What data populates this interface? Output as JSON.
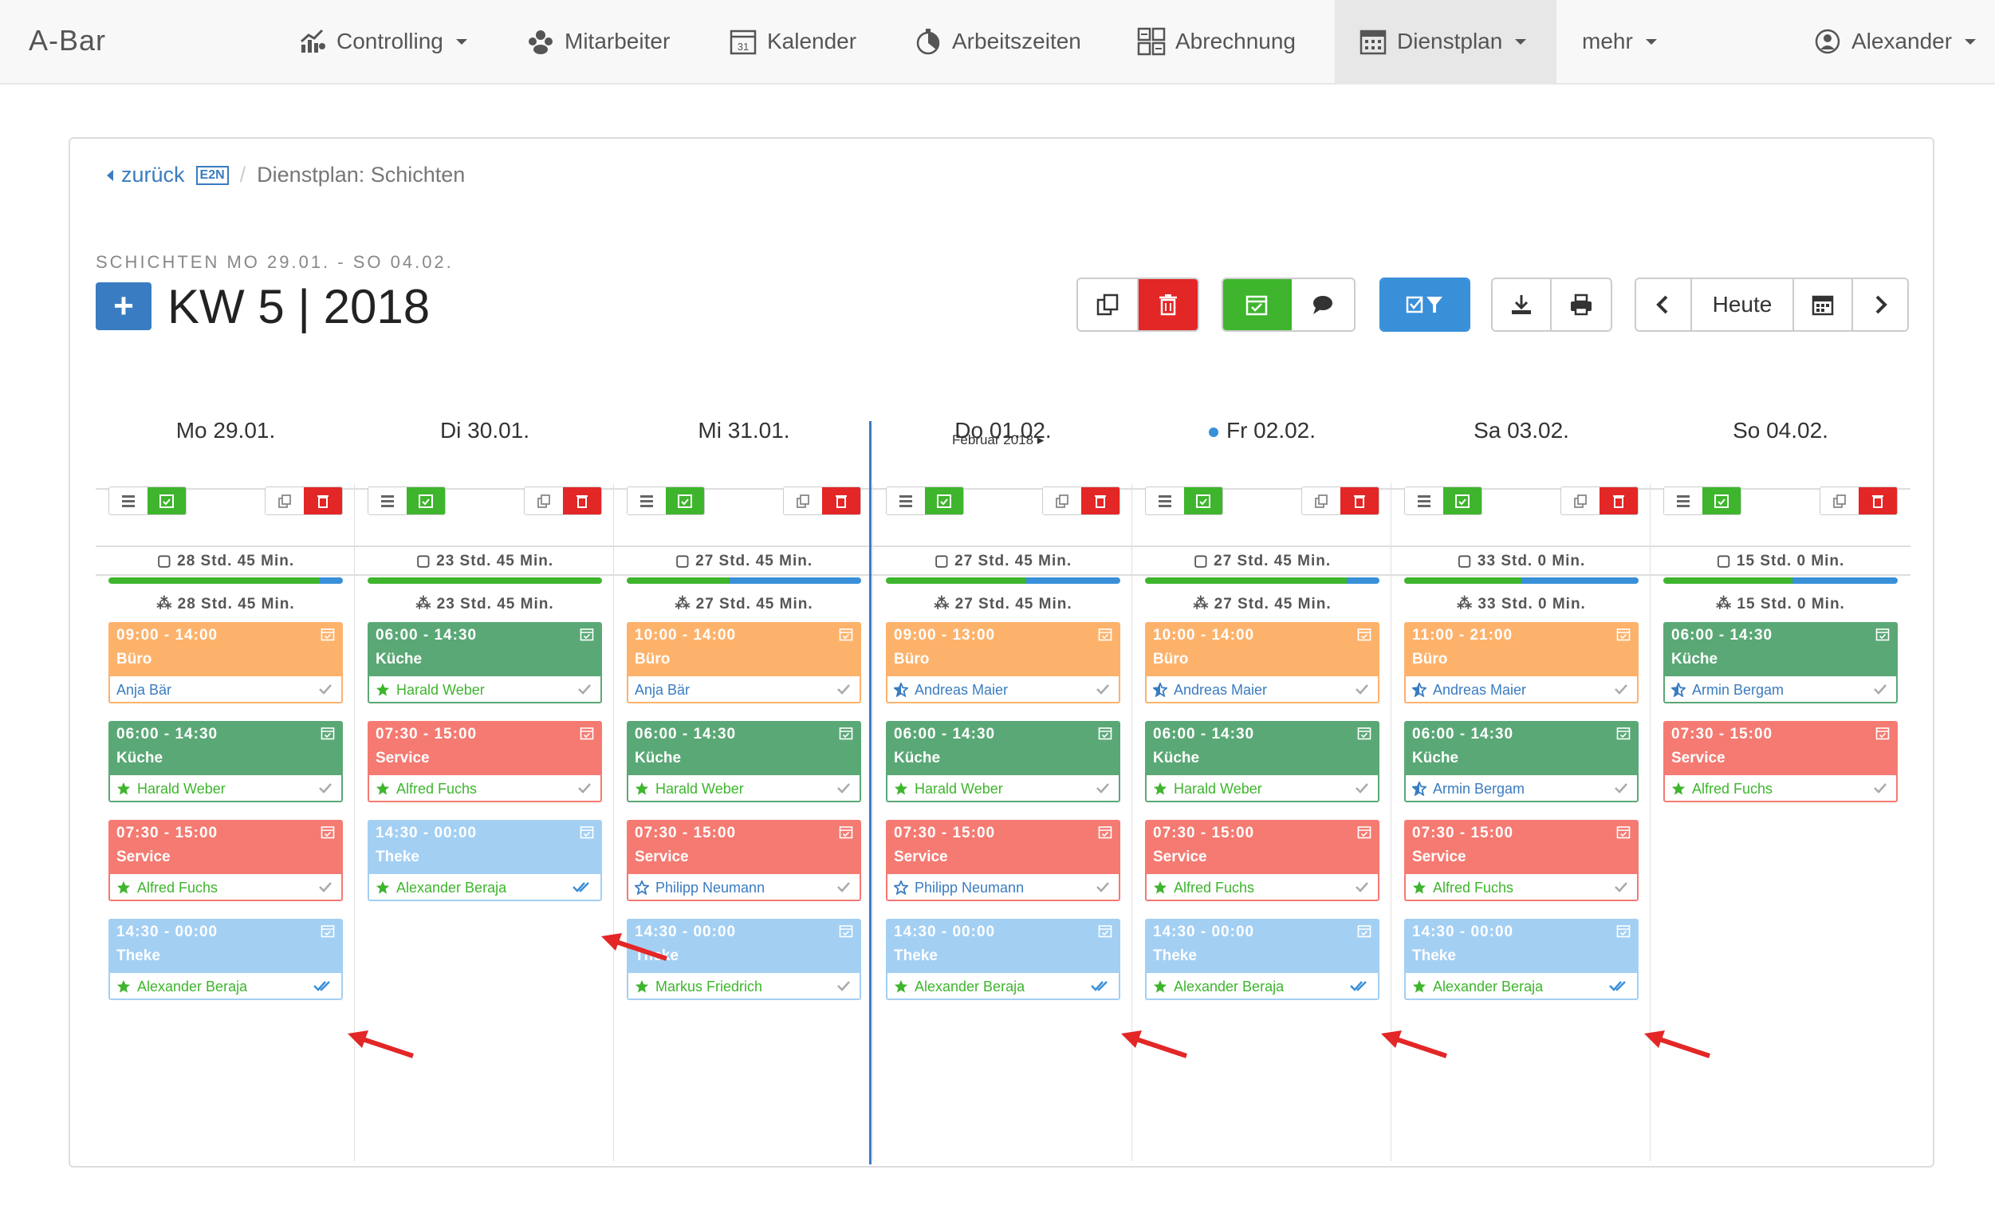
{
  "app": {
    "brand": "A-Bar"
  },
  "nav": {
    "controlling": "Controlling",
    "mitarbeiter": "Mitarbeiter",
    "kalender": "Kalender",
    "arbeitszeiten": "Arbeitszeiten",
    "abrechnung": "Abrechnung",
    "dienstplan": "Dienstplan",
    "mehr": "mehr",
    "user": "Alexander"
  },
  "breadcrumb": {
    "back": "zurück",
    "badge": "E2N",
    "current": "Dienstplan: Schichten"
  },
  "header": {
    "subtitle": "SCHICHTEN  MO 29.01. - SO 04.02.",
    "title": "KW 5 | 2018",
    "add": "+"
  },
  "toolbar": {
    "today": "Heute"
  },
  "month_label": "Februar 2018 ▸",
  "colors": {
    "buero": "#fdb26b",
    "kueche": "#5aa876",
    "service": "#f47a72",
    "theke": "#a3cff3",
    "green": "#3eb52d",
    "red": "#e32626",
    "blue": "#3a8fd9"
  },
  "days": [
    {
      "label": "Mo 29.01.",
      "planned": "28 Std. 45 Min.",
      "actual": "28 Std. 45 Min.",
      "progress": 0.9,
      "today": false,
      "shifts": [
        {
          "time": "09:00 - 14:00",
          "role": "Büro",
          "type": "buero",
          "name": "Anja Bär",
          "star": "none",
          "check": "single"
        },
        {
          "time": "06:00 - 14:30",
          "role": "Küche",
          "type": "kueche",
          "name": "Harald Weber",
          "star": "full",
          "check": "single"
        },
        {
          "time": "07:30 - 15:00",
          "role": "Service",
          "type": "service",
          "name": "Alfred Fuchs",
          "star": "full",
          "check": "single"
        },
        {
          "time": "14:30 - 00:00",
          "role": "Theke",
          "type": "theke",
          "name": "Alexander Beraja",
          "star": "full",
          "check": "double"
        }
      ]
    },
    {
      "label": "Di 30.01.",
      "planned": "23 Std. 45 Min.",
      "actual": "23 Std. 45 Min.",
      "progress": 1.0,
      "today": false,
      "shifts": [
        {
          "time": "06:00 - 14:30",
          "role": "Küche",
          "type": "kueche",
          "name": "Harald Weber",
          "star": "full",
          "check": "single"
        },
        {
          "time": "07:30 - 15:00",
          "role": "Service",
          "type": "service",
          "name": "Alfred Fuchs",
          "star": "full",
          "check": "single"
        },
        {
          "time": "14:30 - 00:00",
          "role": "Theke",
          "type": "theke",
          "name": "Alexander Beraja",
          "star": "full",
          "check": "double"
        }
      ]
    },
    {
      "label": "Mi 31.01.",
      "planned": "27 Std. 45 Min.",
      "actual": "27 Std. 45 Min.",
      "progress": 0.44,
      "today": false,
      "shifts": [
        {
          "time": "10:00 - 14:00",
          "role": "Büro",
          "type": "buero",
          "name": "Anja Bär",
          "star": "none",
          "check": "single"
        },
        {
          "time": "06:00 - 14:30",
          "role": "Küche",
          "type": "kueche",
          "name": "Harald Weber",
          "star": "full",
          "check": "single"
        },
        {
          "time": "07:30 - 15:00",
          "role": "Service",
          "type": "service",
          "name": "Philipp Neumann",
          "star": "outline",
          "check": "single"
        },
        {
          "time": "14:30 - 00:00",
          "role": "Theke",
          "type": "theke",
          "name": "Markus Friedrich",
          "star": "full",
          "check": "single"
        }
      ]
    },
    {
      "label": "Do 01.02.",
      "planned": "27 Std. 45 Min.",
      "actual": "27 Std. 45 Min.",
      "progress": 0.6,
      "today": false,
      "shifts": [
        {
          "time": "09:00 - 13:00",
          "role": "Büro",
          "type": "buero",
          "name": "Andreas Maier",
          "star": "half",
          "check": "single"
        },
        {
          "time": "06:00 - 14:30",
          "role": "Küche",
          "type": "kueche",
          "name": "Harald Weber",
          "star": "full",
          "check": "single"
        },
        {
          "time": "07:30 - 15:00",
          "role": "Service",
          "type": "service",
          "name": "Philipp Neumann",
          "star": "outline",
          "check": "single"
        },
        {
          "time": "14:30 - 00:00",
          "role": "Theke",
          "type": "theke",
          "name": "Alexander Beraja",
          "star": "full",
          "check": "double"
        }
      ]
    },
    {
      "label": "Fr 02.02.",
      "planned": "27 Std. 45 Min.",
      "actual": "27 Std. 45 Min.",
      "progress": 0.86,
      "today": true,
      "shifts": [
        {
          "time": "10:00 - 14:00",
          "role": "Büro",
          "type": "buero",
          "name": "Andreas Maier",
          "star": "half",
          "check": "single"
        },
        {
          "time": "06:00 - 14:30",
          "role": "Küche",
          "type": "kueche",
          "name": "Harald Weber",
          "star": "full",
          "check": "single"
        },
        {
          "time": "07:30 - 15:00",
          "role": "Service",
          "type": "service",
          "name": "Alfred Fuchs",
          "star": "full",
          "check": "single"
        },
        {
          "time": "14:30 - 00:00",
          "role": "Theke",
          "type": "theke",
          "name": "Alexander Beraja",
          "star": "full",
          "check": "double"
        }
      ]
    },
    {
      "label": "Sa 03.02.",
      "planned": "33 Std. 0 Min.",
      "actual": "33 Std. 0 Min.",
      "progress": 0.5,
      "today": false,
      "shifts": [
        {
          "time": "11:00 - 21:00",
          "role": "Büro",
          "type": "buero",
          "name": "Andreas Maier",
          "star": "half",
          "check": "single"
        },
        {
          "time": "06:00 - 14:30",
          "role": "Küche",
          "type": "kueche",
          "name": "Armin Bergam",
          "star": "half",
          "check": "single"
        },
        {
          "time": "07:30 - 15:00",
          "role": "Service",
          "type": "service",
          "name": "Alfred Fuchs",
          "star": "full",
          "check": "single"
        },
        {
          "time": "14:30 - 00:00",
          "role": "Theke",
          "type": "theke",
          "name": "Alexander Beraja",
          "star": "full",
          "check": "double"
        }
      ]
    },
    {
      "label": "So 04.02.",
      "planned": "15 Std. 0 Min.",
      "actual": "15 Std. 0 Min.",
      "progress": 0.55,
      "today": false,
      "shifts": [
        {
          "time": "06:00 - 14:30",
          "role": "Küche",
          "type": "kueche",
          "name": "Armin Bergam",
          "star": "half",
          "check": "single"
        },
        {
          "time": "07:30 - 15:00",
          "role": "Service",
          "type": "service",
          "name": "Alfred Fuchs",
          "star": "full",
          "check": "single"
        }
      ]
    }
  ]
}
